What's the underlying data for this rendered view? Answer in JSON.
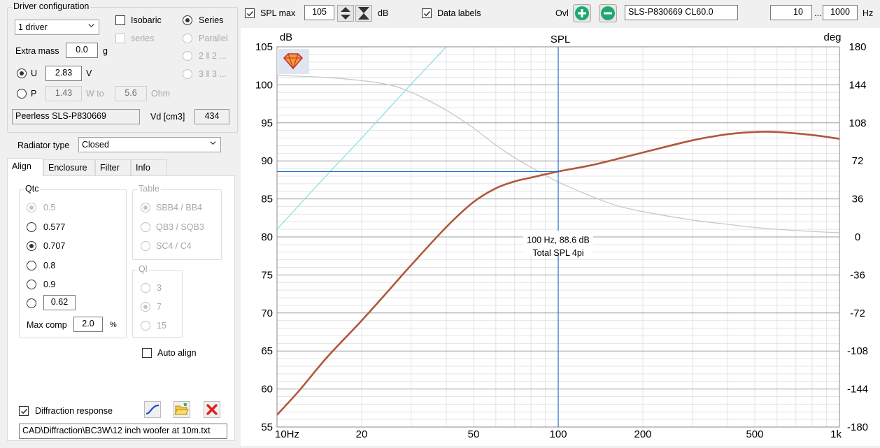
{
  "driver_config": {
    "title": "Driver configuration",
    "driver_count": "1 driver",
    "isobaric_label": "Isobaric",
    "series_label": "Series",
    "series_sub_label": "series",
    "parallel_label": "Parallel",
    "two_parallel_label": "2 ‖ 2 ...",
    "three_parallel_label": "3 ‖ 3 ...",
    "extra_mass_label": "Extra mass",
    "extra_mass_value": "0.0",
    "extra_mass_unit": "g",
    "u_label": "U",
    "u_value": "2.83",
    "u_unit": "V",
    "p_label": "P",
    "p_value": "1.43",
    "p_unit": "W to",
    "ohm_value": "5.6",
    "ohm_unit": "Ohm",
    "driver_name": "Peerless SLS-P830669",
    "vd_label": "Vd [cm3]",
    "vd_value": "434"
  },
  "radiator": {
    "label": "Radiator type",
    "value": "Closed"
  },
  "tabs": [
    {
      "label": "Align"
    },
    {
      "label": "Enclosure"
    },
    {
      "label": "Filter"
    },
    {
      "label": "Info"
    }
  ],
  "align": {
    "qtc_title": "Qtc",
    "qtc_options": [
      "0.5",
      "0.577",
      "0.707",
      "0.8",
      "0.9"
    ],
    "qtc_custom_value": "0.62",
    "max_comp_label": "Max comp",
    "max_comp_value": "2.0",
    "max_comp_unit": "%",
    "table_title": "Table",
    "table_options": [
      "SBB4 / BB4",
      "QB3 / SQB3",
      "SC4 / C4"
    ],
    "ql_title": "Ql",
    "ql_options": [
      "3",
      "7",
      "15"
    ],
    "auto_align_label": "Auto align",
    "diffraction_label": "Diffraction response",
    "diffraction_path": "CAD\\Diffraction\\BC3W\\12 inch woofer at 10m.txt"
  },
  "toolbar": {
    "spl_max_label": "SPL max",
    "spl_max_value": "105",
    "db_unit": "dB",
    "data_labels_label": "Data labels",
    "ovl_label": "Ovl",
    "overlay_name": "SLS-P830669 CL60.0",
    "freq_min": "10",
    "freq_sep": "...",
    "freq_max": "1000",
    "freq_unit": "Hz"
  },
  "colors": {
    "spl_curve": "#b0583a",
    "phase_curve": "#c8c8c8",
    "cyan_curve": "#8fe0e0",
    "cursor": "#1f6fd6",
    "add_button": "#1ea870",
    "remove_button": "#1ea870"
  },
  "chart_data": {
    "type": "line",
    "title": "SPL",
    "ylabel": "dB",
    "y2label": "deg",
    "x_scale": "log",
    "xlim": [
      10,
      1000
    ],
    "ylim": [
      55,
      105
    ],
    "y2lim": [
      -180,
      180
    ],
    "x_ticks": [
      "10Hz",
      "20",
      "50",
      "100",
      "200",
      "500",
      "1k"
    ],
    "y_ticks": [
      "55",
      "60",
      "65",
      "70",
      "75",
      "80",
      "85",
      "90",
      "95",
      "100",
      "105"
    ],
    "y2_ticks": [
      "180",
      "144",
      "108",
      "72",
      "36",
      "0",
      "-36",
      "-72",
      "-108",
      "-144",
      "-180"
    ],
    "grid": true,
    "series": [
      {
        "name": "Total SPL 4pi",
        "axis": "left",
        "x": [
          10,
          12,
          15,
          20,
          25,
          30,
          40,
          50,
          60,
          70,
          80,
          100,
          130,
          160,
          200,
          300,
          400,
          500,
          600,
          800,
          1000
        ],
        "y": [
          56.6,
          59.8,
          64.1,
          69.0,
          73.0,
          76.3,
          81.3,
          84.6,
          86.4,
          87.3,
          87.8,
          88.6,
          89.4,
          90.2,
          91.1,
          92.7,
          93.5,
          93.8,
          93.8,
          93.4,
          92.9
        ]
      },
      {
        "axis": "right",
        "x": [
          10,
          15,
          20,
          25,
          30,
          40,
          50,
          60,
          70,
          80,
          100,
          130,
          160,
          200,
          300,
          400,
          500,
          700,
          1000
        ],
        "y": [
          153,
          151,
          148,
          144,
          137,
          120,
          103,
          87,
          75,
          66,
          52,
          39,
          30,
          24,
          16,
          12,
          9,
          6,
          4
        ]
      },
      {
        "axis": "left",
        "x": [
          10,
          15,
          20,
          30,
          40
        ],
        "y": [
          81.0,
          88.1,
          93.0,
          100.1,
          105.0
        ]
      }
    ],
    "cursor": {
      "x": 100,
      "y": 88.6,
      "label_line1": "100 Hz, 88.6 dB",
      "label_line2": "Total SPL 4pi"
    }
  }
}
